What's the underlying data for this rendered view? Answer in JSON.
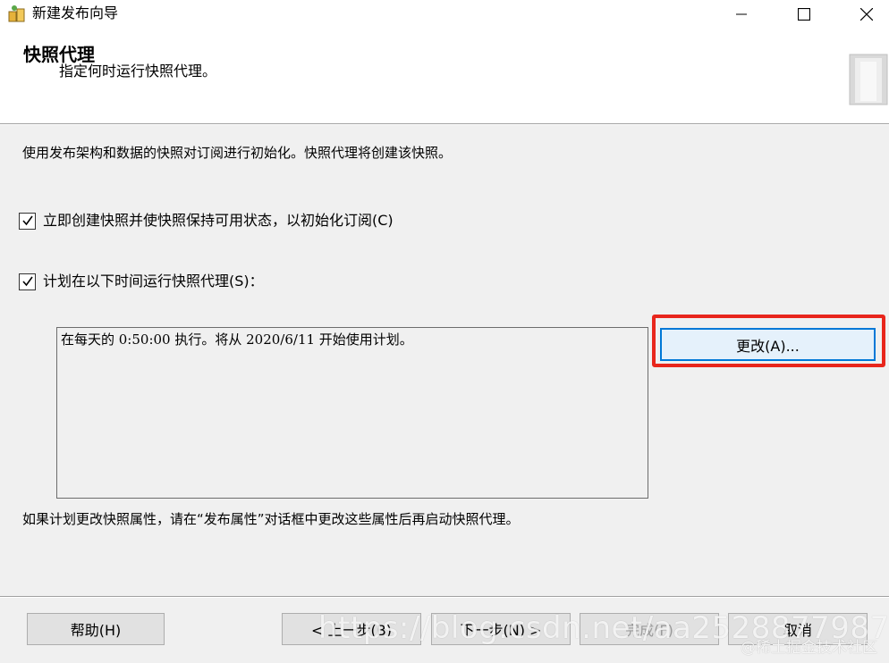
{
  "window": {
    "title": "新建发布向导",
    "icon": "wizard-app-icon"
  },
  "header": {
    "title": "快照代理",
    "subtitle": "指定何时运行快照代理。"
  },
  "main": {
    "intro": "使用发布架构和数据的快照对订阅进行初始化。快照代理将创建该快照。",
    "checkbox_immediate": {
      "label": "立即创建快照并使快照保持可用状态，以初始化订阅(C)",
      "checked": true
    },
    "checkbox_schedule": {
      "label": "计划在以下时间运行快照代理(S)：",
      "checked": true
    },
    "schedule_text": "在每天的 0:50:00 执行。将从 2020/6/11 开始使用计划。",
    "change_button": "更改(A)...",
    "footer_note": "如果计划更改快照属性，请在“发布属性”对话框中更改这些属性后再启动快照代理。"
  },
  "footer": {
    "help": "帮助(H)",
    "back": "< 上一步(B)",
    "next": "下一步(N) >",
    "finish": "完成(F)",
    "cancel": "取消"
  },
  "watermark": {
    "url": "https://blog.csdn.net/aa2528877987",
    "community": "@稀土掘金技术社区"
  },
  "colors": {
    "highlight": "#e8261c",
    "focus": "#0078d7"
  }
}
